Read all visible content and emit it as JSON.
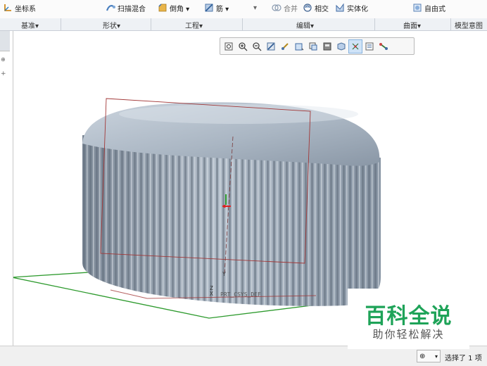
{
  "ribbon": {
    "buttons": [
      {
        "label": "坐标系",
        "icon": "coordinate-system-icon"
      },
      {
        "label": "扫描混合",
        "icon": "swept-blend-icon"
      },
      {
        "label": "倒角 ▾",
        "icon": "chamfer-icon"
      },
      {
        "label": "筋 ▾",
        "icon": "rib-icon"
      },
      {
        "label": "合并",
        "icon": "merge-icon"
      },
      {
        "label": "相交",
        "icon": "intersect-icon"
      },
      {
        "label": "实体化",
        "icon": "solidify-icon"
      },
      {
        "label": "自由式",
        "icon": "freestyle-icon"
      }
    ],
    "groups": [
      "基准▾",
      "形状▾",
      "工程▾",
      "编辑▾",
      "曲面▾",
      "模型意图"
    ]
  },
  "view_toolbar": {
    "tools": [
      "refit-icon",
      "zoom-in-icon",
      "zoom-out-icon",
      "repaint-icon",
      "spin-center-icon",
      "display-style-icon",
      "saved-views-icon",
      "view-manager-icon",
      "appearance-icon",
      "datum-display-icon",
      "annotation-display-icon",
      "spin-mode-icon"
    ],
    "active_index": 9
  },
  "model": {
    "csys_label": "PRT_CSYS_DEF",
    "axis_x": "X",
    "axis_y": "Y",
    "axis_z": "Z"
  },
  "status": {
    "selection_text": "选择了 1 项",
    "filter_icon": "binoculars-icon"
  },
  "watermark": {
    "title": "百科全说",
    "subtitle": "助你轻松解决"
  },
  "colors": {
    "model_fill": "#a9b5c2",
    "model_dark": "#6f7c8a",
    "datum_plane_green": "#2d9a2d",
    "datum_plane_red": "#a23838",
    "watermark_green": "#1ea358"
  }
}
